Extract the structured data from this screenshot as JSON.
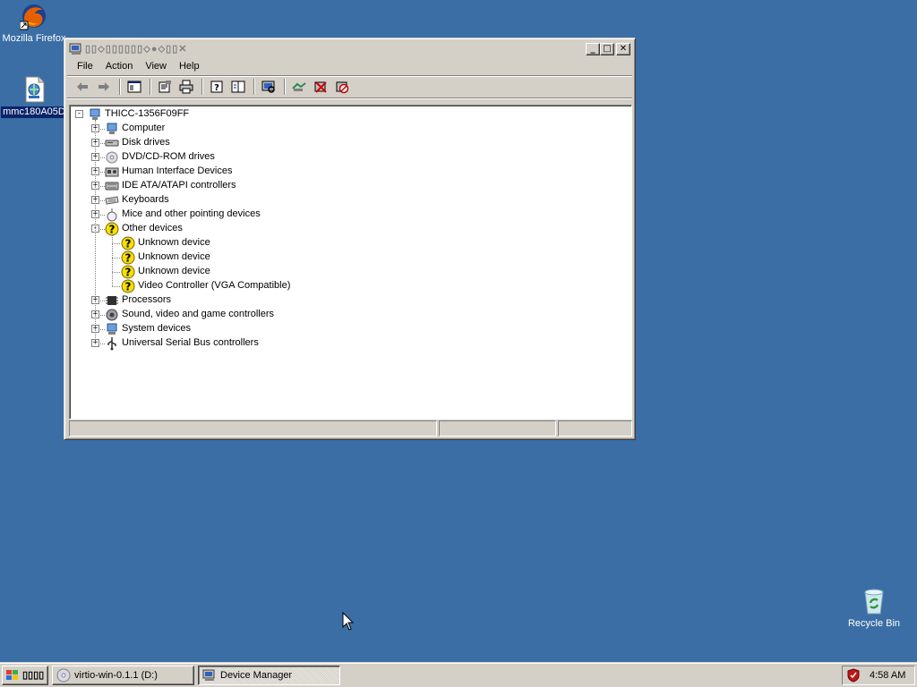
{
  "desktop": {
    "icons": [
      {
        "label": "Mozilla Firefox"
      },
      {
        "label": "mmc180A05D"
      },
      {
        "label": "Recycle Bin"
      }
    ]
  },
  "window": {
    "title": "▯▯⬦▯▯▯▯▯▯⬦●⬦▯▯✕",
    "menu": [
      "File",
      "Action",
      "View",
      "Help"
    ],
    "tree": {
      "root": "THICC-1356F09FF",
      "categories": [
        {
          "label": "Computer",
          "icon": "computer-icon"
        },
        {
          "label": "Disk drives",
          "icon": "disk-drive-icon"
        },
        {
          "label": "DVD/CD-ROM drives",
          "icon": "cdrom-icon"
        },
        {
          "label": "Human Interface Devices",
          "icon": "hid-icon"
        },
        {
          "label": "IDE ATA/ATAPI controllers",
          "icon": "ide-controller-icon"
        },
        {
          "label": "Keyboards",
          "icon": "keyboard-icon"
        },
        {
          "label": "Mice and other pointing devices",
          "icon": "mouse-icon"
        },
        {
          "label": "Other devices",
          "icon": "unknown-device-icon"
        },
        {
          "label": "Processors",
          "icon": "processor-icon"
        },
        {
          "label": "Sound, video and game controllers",
          "icon": "sound-icon"
        },
        {
          "label": "System devices",
          "icon": "system-device-icon"
        },
        {
          "label": "Universal Serial Bus controllers",
          "icon": "usb-icon"
        }
      ],
      "other_devices": [
        "Unknown device",
        "Unknown device",
        "Unknown device",
        "Video Controller (VGA Compatible)"
      ]
    }
  },
  "taskbar": {
    "start_label": "▯▯▯▯",
    "tasks": [
      {
        "label": "virtio-win-0.1.1 (D:)",
        "icon": "cd-icon"
      },
      {
        "label": "Device Manager",
        "icon": "device-manager-icon"
      }
    ],
    "clock": "4:58 AM"
  },
  "colors": {
    "desktop": "#3a6ea5",
    "face": "#d4d0c8",
    "selection": "#0a246a"
  }
}
